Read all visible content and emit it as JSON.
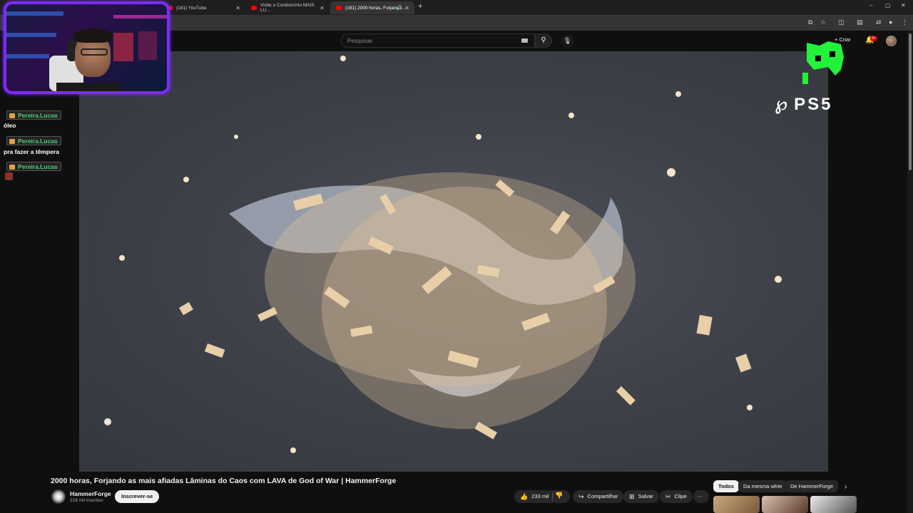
{
  "browser": {
    "tabs": [
      {
        "title": "(181) YouTube",
        "active": false
      },
      {
        "title": "Visite o Condomínio MAIS LU...",
        "active": false
      },
      {
        "title": "(181) 2000 horas, Forjando...",
        "active": true
      }
    ],
    "new_tab": "+",
    "window_controls": [
      "–",
      "▢",
      "✕"
    ]
  },
  "youtube": {
    "search_placeholder": "Pesquisar",
    "create_label": "+ Criar",
    "notification_count": "9+",
    "video": {
      "title": "2000 horas, Forjando as mais afiadas Lâminas do Caos com LAVA de God of War | HammerForge",
      "channel": "HammerForge",
      "subscribers": "216 mil inscritos",
      "subscribe_label": "Inscrever-se",
      "likes": "233 mil",
      "share_label": "Compartilhar",
      "save_label": "Salvar",
      "clip_label": "Clipe",
      "more_label": "···"
    },
    "chips": [
      "Todos",
      "Da mesma série",
      "De HammerForge"
    ]
  },
  "overlay": {
    "chat": [
      {
        "user": "Pereira.Lucas",
        "message": "óleo"
      },
      {
        "user": "Pereira.Lucas",
        "message": "pra fazer a têmpera"
      },
      {
        "user": "Pereira.Lucas",
        "message": ""
      }
    ],
    "ps5_logo": "PS5"
  },
  "colors": {
    "webcam_border": "#7b2cff",
    "chat_name": "#4fd178",
    "youtube_red": "#ff0000"
  }
}
